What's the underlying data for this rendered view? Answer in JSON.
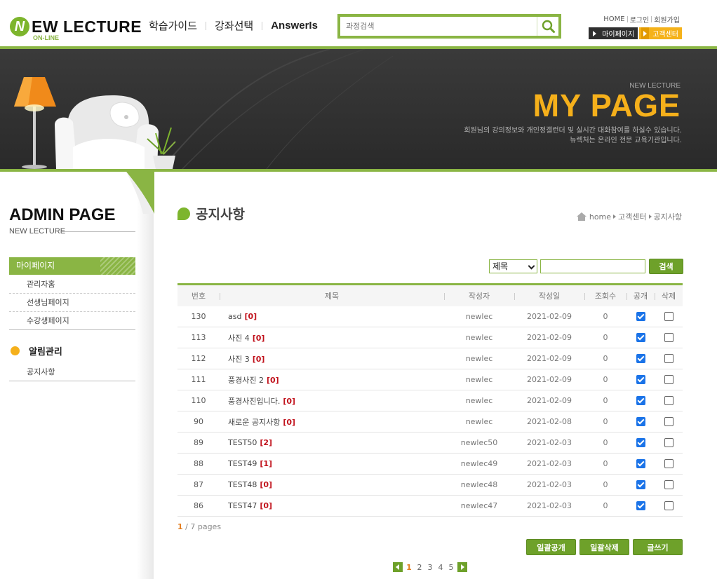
{
  "header": {
    "logo_mark": "N",
    "logo_text": "EW LECTURE",
    "logo_sub": "ON-LINE",
    "nav": [
      "학습가이드",
      "강좌선택",
      "AnswerIs"
    ],
    "search_placeholder": "과정검색",
    "util_links": [
      "HOME",
      "로그인",
      "회원가입"
    ],
    "quick_mypage": "마이페이지",
    "quick_customer": "고객센터"
  },
  "visual": {
    "tag": "NEW LECTURE",
    "title": "MY PAGE",
    "desc_line1": "회원님의 강의정보와 개인정갤런더 및 실시간 대화참여를 하실수 있습니다.",
    "desc_line2": "뉴렉처는 온라인 전문 교육기관입니다."
  },
  "aside": {
    "title": "ADMIN PAGE",
    "subtitle": "NEW LECTURE",
    "menu1_head": "마이페이지",
    "menu1_items": [
      "관리자홈",
      "선생님페이지",
      "수강생페이지"
    ],
    "menu2_head": "알림관리",
    "menu2_items": [
      "공지사항"
    ]
  },
  "main": {
    "title": "공지사항",
    "breadcrumb": [
      "home",
      "고객센터",
      "공지사항"
    ],
    "filter_field": "제목",
    "filter_value": "",
    "search_button": "검색",
    "columns": [
      "번호",
      "제목",
      "작성자",
      "작성일",
      "조회수",
      "공개",
      "삭제"
    ],
    "rows": [
      {
        "id": "130",
        "title": "asd",
        "comments": "[0]",
        "writer": "newlec",
        "date": "2021-02-09",
        "hit": "0",
        "open": true,
        "del": false
      },
      {
        "id": "113",
        "title": "사진 4",
        "comments": "[0]",
        "writer": "newlec",
        "date": "2021-02-09",
        "hit": "0",
        "open": true,
        "del": false
      },
      {
        "id": "112",
        "title": "사진 3",
        "comments": "[0]",
        "writer": "newlec",
        "date": "2021-02-09",
        "hit": "0",
        "open": true,
        "del": false
      },
      {
        "id": "111",
        "title": "풍경사진 2",
        "comments": "[0]",
        "writer": "newlec",
        "date": "2021-02-09",
        "hit": "0",
        "open": true,
        "del": false
      },
      {
        "id": "110",
        "title": "풍경사진입니다.",
        "comments": "[0]",
        "writer": "newlec",
        "date": "2021-02-09",
        "hit": "0",
        "open": true,
        "del": false
      },
      {
        "id": "90",
        "title": "새로운 공지사항",
        "comments": "[0]",
        "writer": "newlec",
        "date": "2021-02-08",
        "hit": "0",
        "open": true,
        "del": false
      },
      {
        "id": "89",
        "title": "TEST50",
        "comments": "[2]",
        "writer": "newlec50",
        "date": "2021-02-03",
        "hit": "0",
        "open": true,
        "del": false
      },
      {
        "id": "88",
        "title": "TEST49",
        "comments": "[1]",
        "writer": "newlec49",
        "date": "2021-02-03",
        "hit": "0",
        "open": true,
        "del": false
      },
      {
        "id": "87",
        "title": "TEST48",
        "comments": "[0]",
        "writer": "newlec48",
        "date": "2021-02-03",
        "hit": "0",
        "open": true,
        "del": false
      },
      {
        "id": "86",
        "title": "TEST47",
        "comments": "[0]",
        "writer": "newlec47",
        "date": "2021-02-03",
        "hit": "0",
        "open": true,
        "del": false
      }
    ],
    "page_current": "1",
    "page_total": " / 7 pages",
    "bottom_buttons": [
      "일괄공개",
      "일괄삭제",
      "글쓰기"
    ],
    "pages": [
      "1",
      "2",
      "3",
      "4",
      "5"
    ]
  },
  "colors": {
    "accent_green": "#8ab544",
    "button_green": "#6ea12a",
    "title_gold": "#f5b01b",
    "comment_red": "#c1121c",
    "page_orange": "#e37d1e"
  }
}
